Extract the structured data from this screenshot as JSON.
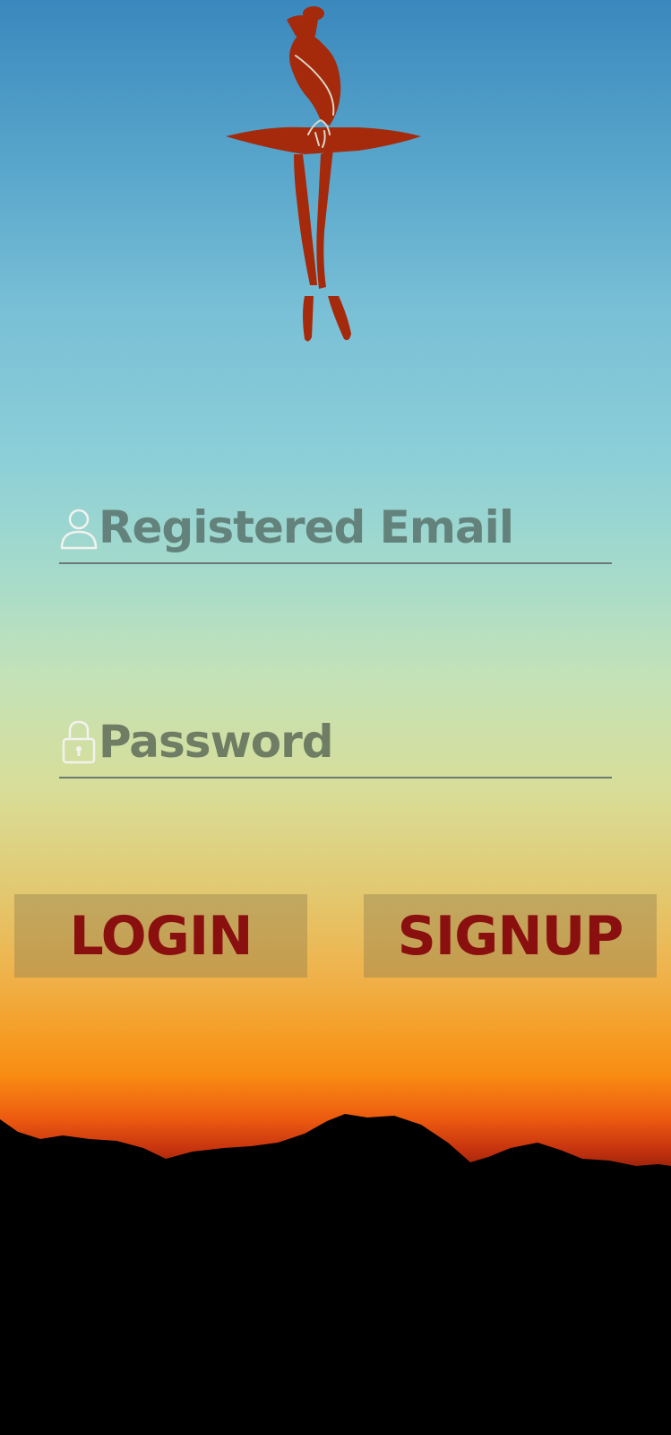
{
  "login_form": {
    "email": {
      "placeholder": "Registered Email",
      "icon": "user-icon"
    },
    "password": {
      "placeholder": "Password",
      "icon": "lock-icon"
    }
  },
  "actions": {
    "login_label": "LOGIN",
    "signup_label": "SIGNUP"
  },
  "colors": {
    "brand": "#a52a0c",
    "button_text": "#8a0f0f",
    "sky_top": "#3a88bd",
    "sunset_orange": "#f98b12"
  }
}
